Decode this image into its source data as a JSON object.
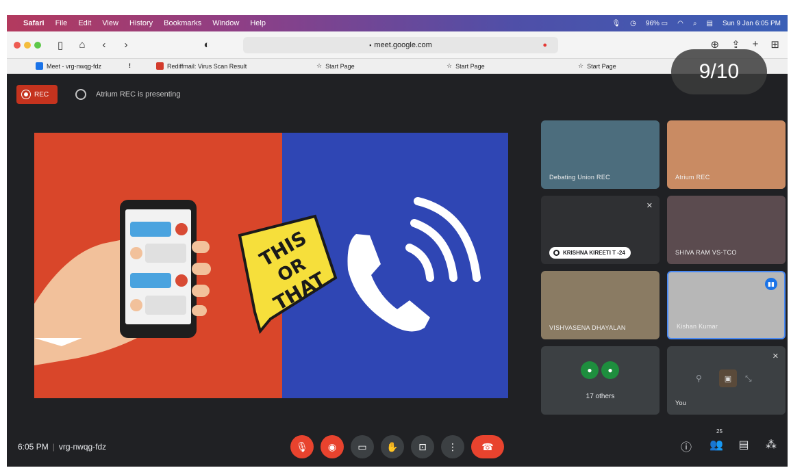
{
  "menubar": {
    "apple": "",
    "items": [
      "Safari",
      "File",
      "Edit",
      "View",
      "History",
      "Bookmarks",
      "Window",
      "Help"
    ],
    "battery": "96%",
    "datetime": "Sun 9 Jan  6:05 PM"
  },
  "toolbar": {
    "url": "meet.google.com"
  },
  "bookmarks": [
    {
      "label": "Meet - vrg-nwqg-fdz",
      "color": "#1a73e8"
    },
    {
      "label": "Rediffmail: Virus Scan Result",
      "color": "#d33b2c"
    },
    {
      "label": "Start Page",
      "color": ""
    },
    {
      "label": "Start Page",
      "color": ""
    },
    {
      "label": "Start Page",
      "color": ""
    }
  ],
  "page_counter": "9/10",
  "meet": {
    "rec_label": "REC",
    "presenting_text": "Atrium REC is presenting",
    "slide_text": [
      "THIS",
      "OR",
      "THAT"
    ],
    "tiles": [
      {
        "name": "Debating Union REC",
        "bg": "#5a7a8a"
      },
      {
        "name": "Atrium REC",
        "bg": "#c98b63"
      },
      {
        "name": "KRISHNA KIREETI T -24",
        "bg": "#2f3033",
        "badge": true,
        "muted": true
      },
      {
        "name": "SHIVA RAM VS-TCO",
        "bg": "#5b4b4f"
      },
      {
        "name": "VISHVASENA DHAYALAN",
        "bg": "#8a7b63"
      },
      {
        "name": "Kishan Kumar",
        "bg": "#b7b7b7",
        "speaking": true
      },
      {
        "name": "17 others",
        "bg": "#3c4043"
      },
      {
        "name": "You",
        "bg": "#3c4043",
        "muted": true
      }
    ],
    "time": "6:05 PM",
    "meeting_code": "vrg-nwqg-fdz",
    "participants_count": "25"
  }
}
